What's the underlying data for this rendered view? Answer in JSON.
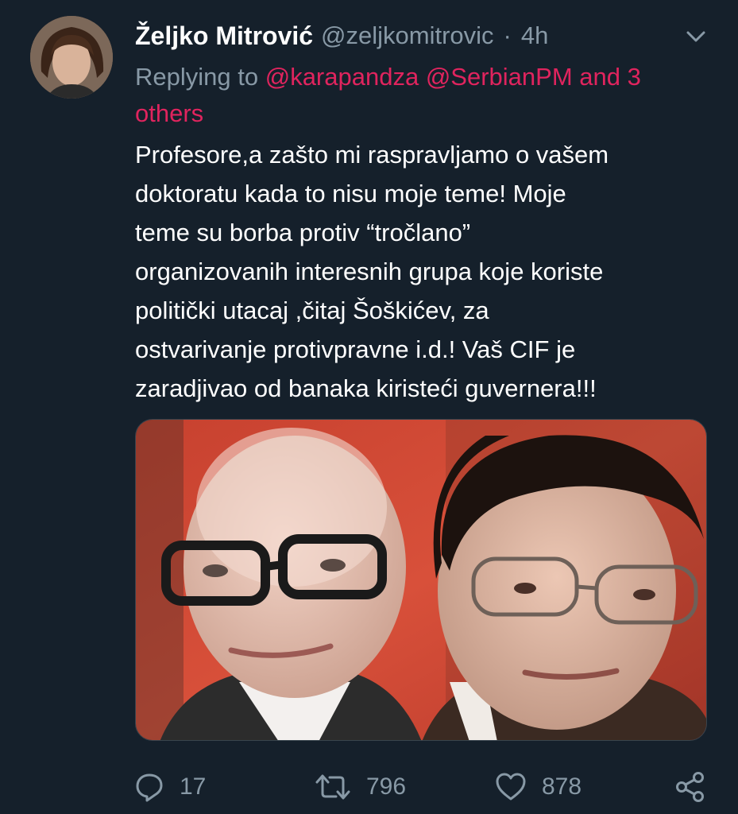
{
  "tweet": {
    "author": {
      "display_name": "Željko Mitrović",
      "handle": "@zeljkomitrovic",
      "separator": "·",
      "time": "4h"
    },
    "reply": {
      "prefix": "Replying to ",
      "mention_1": "@karapandza",
      "mention_2": "@SerbianPM",
      "mention_3": "and 3",
      "mention_4": "others"
    },
    "text_lines": [
      "Profesore,a zašto mi raspravljamo o vašem",
      "doktoratu kada to nisu moje teme! Moje",
      "teme su borba protiv “tročlano”",
      "organizovanih interesnih grupa koje koriste",
      "politički utacaj ,čitaj Šoškićev, za",
      "ostvarivanje protivpravne i.d.! Vaš CIF je",
      "zaradjivao od banaka kiristeći guvernera!!!"
    ],
    "media": {
      "icon": "photo-of-two-men"
    },
    "actions": {
      "reply_count": "17",
      "retweet_count": "796",
      "like_count": "878"
    }
  },
  "colors": {
    "background": "#15202b",
    "secondary_text": "#8899a6",
    "mention": "#e0245e",
    "primary_text": "#ffffff"
  }
}
